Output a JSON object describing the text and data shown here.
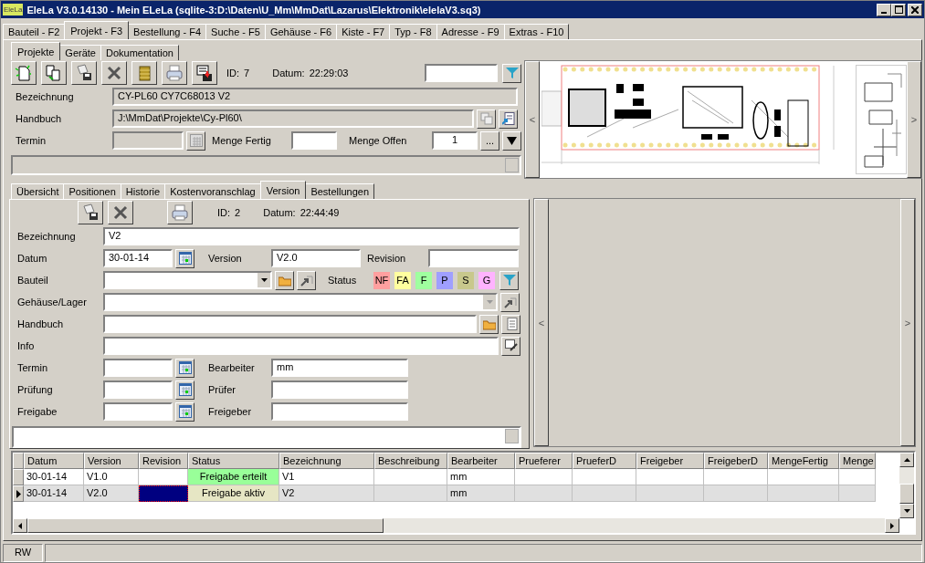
{
  "window": {
    "title": "EleLa V3.0.14130  - Mein ELeLa (sqlite-3:D:\\Daten\\U_Mm\\MmDat\\Lazarus\\Elektronik\\elelaV3.sq3)",
    "logo": "EleLa"
  },
  "main_tabs": [
    {
      "label": "Bauteil - F2",
      "selected": false
    },
    {
      "label": "Projekt - F3",
      "selected": true
    },
    {
      "label": "Bestellung - F4",
      "selected": false
    },
    {
      "label": "Suche - F5",
      "selected": false
    },
    {
      "label": "Gehäuse - F6",
      "selected": false
    },
    {
      "label": "Kiste - F7",
      "selected": false
    },
    {
      "label": "Typ - F8",
      "selected": false
    },
    {
      "label": "Adresse - F9",
      "selected": false
    },
    {
      "label": "Extras - F10",
      "selected": false
    }
  ],
  "project_tabs": [
    {
      "label": "Projekte",
      "selected": true
    },
    {
      "label": "Geräte",
      "selected": false
    },
    {
      "label": "Dokumentation",
      "selected": false
    }
  ],
  "project": {
    "id_label": "ID:",
    "id": "7",
    "date_label": "Datum:",
    "date": "22:29:03",
    "bezeichnung_label": "Bezeichnung",
    "bezeichnung": "CY-PL60 CY7C68013 V2",
    "handbuch_label": "Handbuch",
    "handbuch": "J:\\MmDat\\Projekte\\Cy-Pl60\\",
    "termin_label": "Termin",
    "menge_fertig_label": "Menge Fertig",
    "menge_offen_label": "Menge Offen",
    "menge_offen": "1",
    "more_button": "..."
  },
  "pcb_panel": {
    "prev": "<",
    "next": ">"
  },
  "version_tabs": [
    {
      "label": "Übersicht",
      "selected": false
    },
    {
      "label": "Positionen",
      "selected": false
    },
    {
      "label": "Historie",
      "selected": false
    },
    {
      "label": "Kostenvoranschlag",
      "selected": false
    },
    {
      "label": "Version",
      "selected": true
    },
    {
      "label": "Bestellungen",
      "selected": false
    }
  ],
  "version": {
    "id_label": "ID:",
    "id": "2",
    "date_label": "Datum:",
    "date": "22:44:49",
    "bezeichnung_label": "Bezeichnung",
    "bezeichnung": "V2",
    "datum_label": "Datum",
    "datum": "30-01-14",
    "version_label": "Version",
    "version": "V2.0",
    "revision_label": "Revision",
    "bauteil_label": "Bauteil",
    "status_label": "Status",
    "status_buttons": [
      {
        "label": "NF",
        "color": "#ff9f9f"
      },
      {
        "label": "FA",
        "color": "#ffff9f"
      },
      {
        "label": "F",
        "color": "#9fff9f"
      },
      {
        "label": "P",
        "color": "#9f9fff"
      },
      {
        "label": "S",
        "color": "#c8c88c"
      },
      {
        "label": "G",
        "color": "#ffb3ff"
      }
    ],
    "gehaeuse_label": "Gehäuse/Lager",
    "handbuch_label": "Handbuch",
    "info_label": "Info",
    "termin_label": "Termin",
    "bearbeiter_label": "Bearbeiter",
    "bearbeiter": "mm",
    "pruefung_label": "Prüfung",
    "pruefer_label": "Prüfer",
    "freigabe_label": "Freigabe",
    "freigeber_label": "Freigeber"
  },
  "side_panel": {
    "prev": "<",
    "next": ">"
  },
  "table": {
    "columns": [
      "Datum",
      "Version",
      "Revision",
      "Status",
      "Bezeichnung",
      "Beschreibung",
      "Bearbeiter",
      "Prueferer",
      "PrueferD",
      "Freigeber",
      "FreigeberD",
      "MengeFertig",
      "Menge"
    ],
    "rows": [
      {
        "selected": false,
        "color": "#99ff99",
        "datum": "30-01-14",
        "version": "V1.0",
        "status": "Freigabe erteilt",
        "bezeichnung": "V1",
        "bearbeiter": "mm"
      },
      {
        "selected": true,
        "color": "#e6e6c4",
        "datum": "30-01-14",
        "version": "V2.0",
        "status": "Freigabe aktiv",
        "bezeichnung": "V2",
        "bearbeiter": "mm"
      }
    ]
  },
  "status_bar": {
    "mode": "RW"
  }
}
